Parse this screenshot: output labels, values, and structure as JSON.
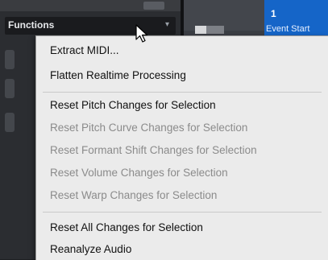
{
  "panel": {
    "functions_label": "Functions",
    "chevron": "▾"
  },
  "timeline": {
    "event_number": "1",
    "event_start_label": "Event Start"
  },
  "menu": {
    "items": [
      {
        "label": "Extract MIDI...",
        "enabled": true
      },
      {
        "label": "Flatten Realtime Processing",
        "enabled": true
      },
      {
        "label": "Reset Pitch Changes for Selection",
        "enabled": true
      },
      {
        "label": "Reset Pitch Curve Changes for Selection",
        "enabled": false
      },
      {
        "label": "Reset Formant Shift Changes for Selection",
        "enabled": false
      },
      {
        "label": "Reset Volume Changes for Selection",
        "enabled": false
      },
      {
        "label": "Reset Warp Changes for Selection",
        "enabled": false
      },
      {
        "label": "Reset All Changes for Selection",
        "enabled": true
      },
      {
        "label": "Reanalyze Audio",
        "enabled": true
      }
    ]
  },
  "colors": {
    "event_blue": "#1565c8",
    "menu_bg": "#ebebeb",
    "disabled_text": "#8b8b8b"
  }
}
